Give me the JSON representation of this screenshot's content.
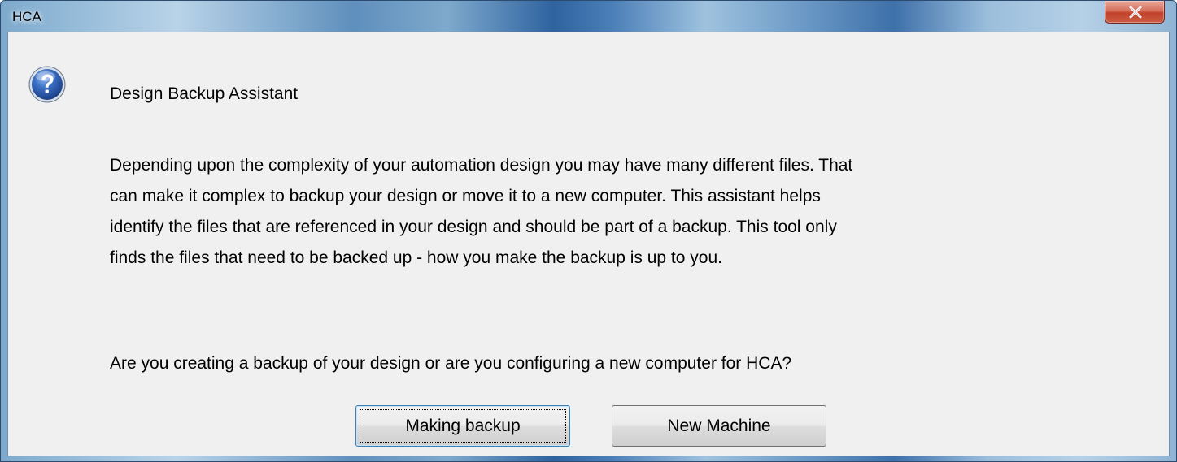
{
  "window": {
    "title": "HCA",
    "close_symbol": "x"
  },
  "dialog": {
    "icon": "question-icon",
    "heading": "Design Backup Assistant",
    "body_lines": [
      "Depending upon the complexity of your automation design you may have many different files. That",
      "can make it complex to backup your design or move it to a new computer. This assistant helps",
      "identify the files that are referenced in your design and should be part of a backup. This tool only",
      "finds the files that need to be backed up - how you make the backup is up to you."
    ],
    "question": "Are you creating a backup of your design or are you configuring a new computer for HCA?"
  },
  "buttons": {
    "making_backup": "Making backup",
    "new_machine": "New Machine"
  },
  "colors": {
    "client_background": "#f0f0f0",
    "close_button": "#c1412a",
    "focus_border": "#3c7fb1",
    "icon_blue": "#2c5fb0"
  }
}
